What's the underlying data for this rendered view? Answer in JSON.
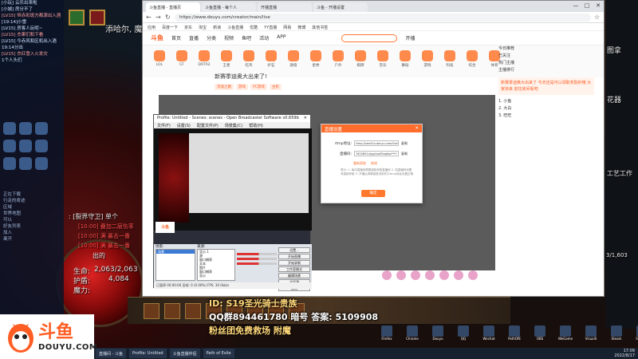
{
  "colors": {
    "brand": "#ff5d23",
    "dialog_header": "#ff6d2d",
    "game_red": "#ff4d4d"
  },
  "left_chat": {
    "lines": [
      "[小玩] 云乐出来啦",
      "[小城] 房分不了",
      "[LV15] 恒赤彩斑方都源出入酒",
      "[19:14]小雪",
      "[LV15] 房客人玩呢~",
      "[LV15] 杰果们和下看",
      "[LV15] 今赤风和区机出入酒",
      "19:14分出",
      "[LV15] 杰红雪入火发灾",
      "1个人头们"
    ]
  },
  "left_tasks": [
    "正在下载",
    "行走的奇迹",
    "区域",
    "世界地图",
    "可以",
    "好友列表",
    "加入",
    "离开"
  ],
  "game": {
    "top_text": "添哈尔, 魔",
    "left_title": ": [裂界守卫] 单个",
    "red_lines": [
      "[10:00] 叠加二层伤率",
      "[10:00] 满 暴击一番",
      "[10:00] 满 暴击一番"
    ],
    "out_text": "出的",
    "life_label": "生命:",
    "life_value": "2,063/2,063",
    "shield_label": "护盾:",
    "shield_value": "4,084",
    "mana_label": "魔力:",
    "right_side_text": "图拿",
    "right_side_text2": "花器",
    "right_side_text3": "工艺工作",
    "counter": "3/1,603"
  },
  "browser": {
    "tabs": [
      "斗鱼直播 - 直播页",
      "斗鱼直播 - 每个人",
      "开播直播",
      "斗鱼 - 开播设置"
    ],
    "url": "https://www.douyu.com/creator/main/live",
    "bookmarks": [
      "应用",
      "百度一下",
      "京东",
      "淘宝",
      "新浪",
      "斗鱼直播",
      "优酷",
      "YY直播",
      "网易",
      "微博",
      "其他书签"
    ],
    "window_buttons": [
      "—",
      "□",
      "✕"
    ]
  },
  "douyu": {
    "logo": "斗鱼",
    "nav": [
      "首页",
      "直播",
      "分类",
      "视频",
      "鱼吧",
      "活动",
      "APP"
    ],
    "nav_right": "开播",
    "categories": [
      "LOL",
      "CF",
      "DOTA2",
      "王者",
      "吃鸡",
      "炉石",
      "颜值",
      "星秀",
      "户外",
      "棋牌",
      "音乐",
      "舞蹈",
      "游戏",
      "科技",
      "综合",
      "体育"
    ],
    "stream_title": "新赛季迪奥大出来了!",
    "tags": [
      "流放之路",
      "游戏",
      "PC游戏",
      "主机"
    ],
    "sidebar_lines": [
      "今日推荐",
      "已关注",
      "热门主播",
      "主播排行"
    ],
    "notice": "新赛季迪奥大出来了 今天还是可以领取奖励的哦 大家快来 前往房间看吧",
    "rank_lines": [
      "1. 小鱼",
      "2. 大白",
      "3. 旺旺"
    ]
  },
  "obs": {
    "title": "Profile: Untitled - Scenes: scenes - Open Broadcaster Software v0.659b",
    "menu": [
      "文件(F)",
      "设置(S)",
      "配置文件(P)",
      "场景集(C)",
      "帮助(H)"
    ],
    "scenes_label": "场景:",
    "sources_label": "来源:",
    "scenes": [
      "场景"
    ],
    "sources": [
      "显示 1",
      "源",
      "窗口捕获",
      "文本",
      "图片",
      "窗口捕获",
      "显示"
    ],
    "buttons": [
      "设置...",
      "开始直播",
      "开始录制",
      "工作室模式",
      "编辑场景",
      "全局源",
      "退出"
    ],
    "status": "已暂停 00:00:00 丢帧: 0 (0.00%)  FPS: 30  0kb/s"
  },
  "dialog": {
    "title": "直播设置",
    "rtmp_label": "rtmp地址:",
    "rtmp_value": "rtmp://send1a.douyu.com/live",
    "rtmp_copy": "复制",
    "code_label": "直播码:",
    "code_value": "7610891rAgq1wAFbqAbo****",
    "code_copy": "复制",
    "link_a": "重新获取",
    "link_b": "修改",
    "tip": "提示: 1. 每次直播前需要重新获取直播码 2. 如直播码泄露请重新获取 3. 开播后请确保推流软件中rtmp地址设置正确",
    "button": "确定"
  },
  "overlay": {
    "logo_text": "斗鱼",
    "logo_sub": "DOUYU.COM",
    "line1": "ID: S19圣光骑士贵族",
    "line2": "QQ群894461780 暗号 答案: 5109908",
    "line3": "粉丝团免费救场 附魔"
  },
  "taskbar": {
    "items": [
      "直播间 - 斗鱼",
      "Profile: Untitled",
      "斗鱼直播伴侣",
      "Path of Exile"
    ],
    "tray_items": [
      "Firefox",
      "Chrome",
      "Douyu",
      "QQ",
      "Wechat",
      "PathOfE",
      "OBS",
      "WeGame",
      "VisualS",
      "Steam",
      "Steam2",
      "网页"
    ],
    "time": "17:09",
    "date": "2022/8/17"
  }
}
